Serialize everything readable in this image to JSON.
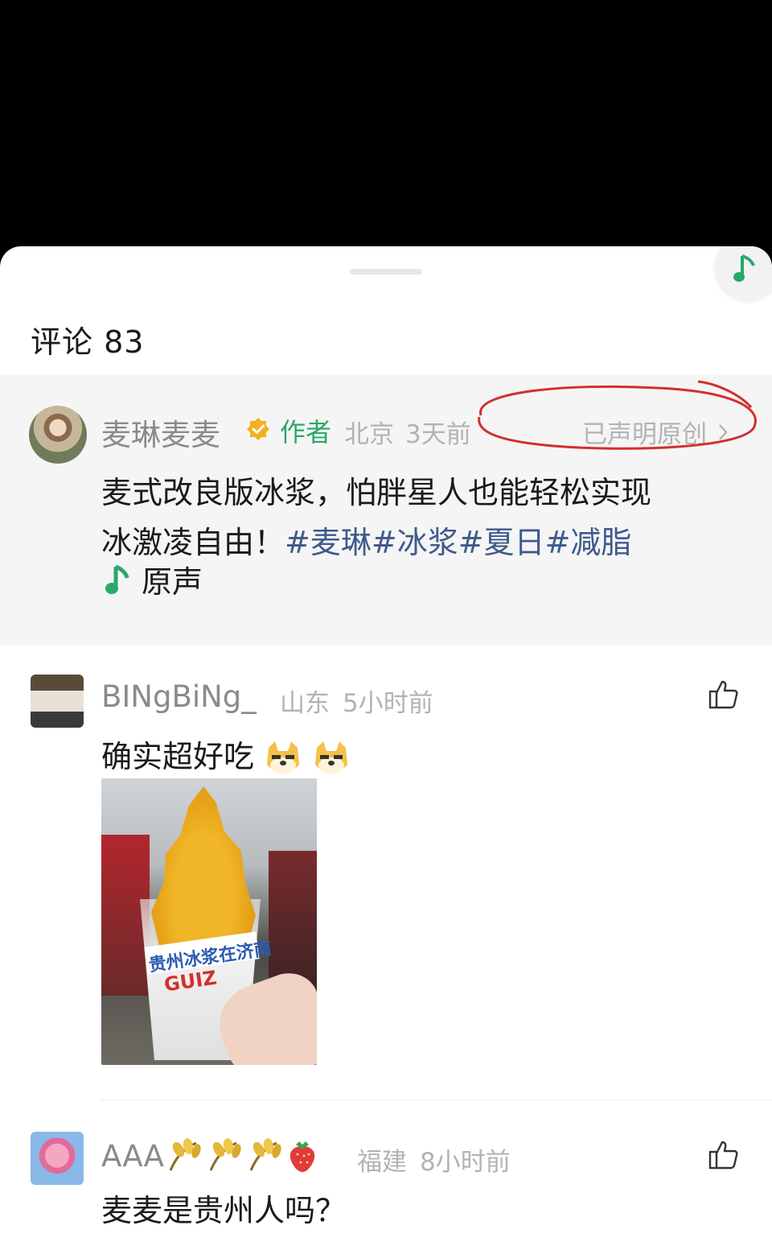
{
  "sheet": {
    "title": "评论 83"
  },
  "author_comment": {
    "name": "麦琳麦麦",
    "author_tag": "作者",
    "location": "北京",
    "time": "3天前",
    "original_claim": "已声明原创",
    "text_line1": "麦式改良版冰浆，怕胖星人也能轻松实现",
    "text_line2_plain": "冰激凌自由！",
    "hashtags": [
      "#麦琳",
      "#冰浆",
      "#夏日",
      "#减脂"
    ],
    "sound_label": "原声"
  },
  "comments": [
    {
      "name": "BINgBiNg_",
      "location": "山东",
      "time": "5小时前",
      "text": "确实超好吃",
      "photo_cup_text": "贵州冰浆在济南",
      "photo_brand_text": "GUIZ"
    },
    {
      "name": "AAA",
      "location": "福建",
      "time": "8小时前",
      "text": "麦麦是贵州人吗？"
    }
  ],
  "colors": {
    "accent_green": "#2aa86a",
    "hashtag_blue": "#3f5a8c",
    "annotation_red": "#d32f2f",
    "meta_gray": "#b3b3b3"
  },
  "icons": [
    "music-note-icon",
    "verified-badge-icon",
    "chevron-right-icon",
    "thumbs-up-icon",
    "doge-emoji-icon",
    "wheat-emoji-icon",
    "strawberry-emoji-icon"
  ]
}
